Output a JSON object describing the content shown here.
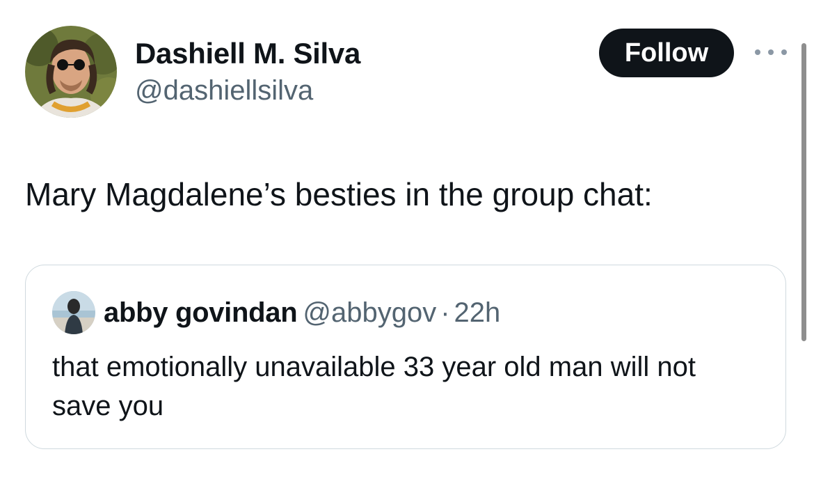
{
  "author": {
    "name": "Dashiell M. Silva",
    "handle": "@dashiellsilva",
    "avatar_icon": "profile-photo"
  },
  "follow_label": "Follow",
  "more_icon": "more-horizontal-icon",
  "tweet": {
    "text": "Mary Magdalene’s besties in the group chat:"
  },
  "quote": {
    "name": "abby govindan",
    "handle": "@abbygov",
    "separator": "·",
    "time": "22h",
    "text": "that emotionally unavailable 33 year old man will not save you",
    "avatar_icon": "profile-photo"
  },
  "colors": {
    "text_primary": "#0f1419",
    "text_secondary": "#536471",
    "follow_bg": "#0f1419",
    "card_border": "#cfd9de"
  }
}
